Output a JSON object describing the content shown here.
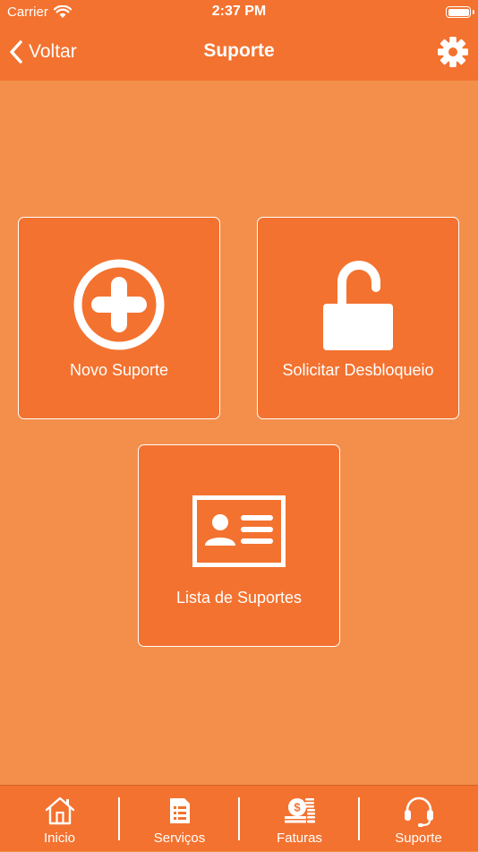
{
  "status_bar": {
    "carrier": "Carrier",
    "time": "2:37 PM"
  },
  "nav": {
    "back_label": "Voltar",
    "title": "Suporte"
  },
  "tiles": [
    {
      "label": "Novo Suporte",
      "icon": "plus-circle-icon"
    },
    {
      "label": "Solicitar Desbloqueio",
      "icon": "unlock-icon"
    },
    {
      "label": "Lista de Suportes",
      "icon": "id-card-icon"
    }
  ],
  "tabbar": {
    "items": [
      {
        "label": "Inicio",
        "icon": "home-icon"
      },
      {
        "label": "Serviços",
        "icon": "document-list-icon"
      },
      {
        "label": "Faturas",
        "icon": "money-icon"
      },
      {
        "label": "Suporte",
        "icon": "headset-icon"
      }
    ]
  },
  "colors": {
    "background": "#F38F4B",
    "primary": "#F3722F",
    "foreground": "#FFFFFF"
  }
}
